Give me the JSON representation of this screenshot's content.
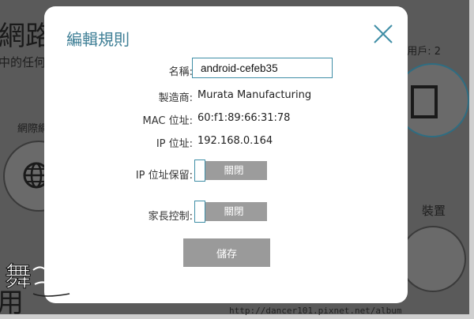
{
  "background": {
    "title": "網路",
    "subtitle": "中的任何",
    "users_count": "用戶: 2",
    "network_label": "網際網",
    "device_label": "裝置",
    "bottom_text": "用"
  },
  "modal": {
    "title": "編輯規則",
    "fields": {
      "name_label": "名稱:",
      "name_value": "android-cefeb35",
      "manufacturer_label": "製造商:",
      "manufacturer_value": "Murata Manufacturing",
      "mac_label": "MAC 位址:",
      "mac_value": "60:f1:89:66:31:78",
      "ip_label": "IP 位址:",
      "ip_value": "192.168.0.164"
    },
    "toggles": {
      "ip_reservation_label": "IP 位址保留:",
      "ip_reservation_state": "關閉",
      "parental_label": "家長控制:",
      "parental_state": "關閉"
    },
    "save_label": "儲存"
  },
  "watermark": {
    "url": "http://dancer101.pixnet.net/album",
    "logo_text": "舞"
  },
  "colors": {
    "accent": "#3f7f96",
    "toggle_off": "#9c9c9c",
    "overlay": "#5a5a5a"
  }
}
